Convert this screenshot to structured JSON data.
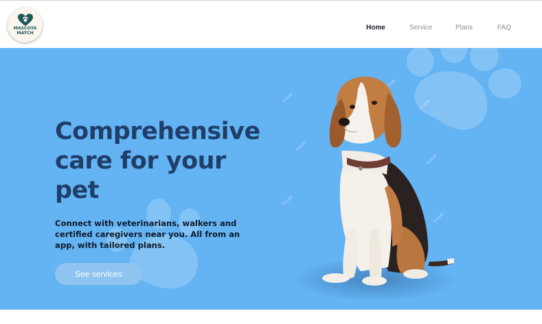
{
  "brand": {
    "logo_line1": "MASCOTA",
    "logo_line2": "MATCH",
    "logo_icon": "heart-paw-icon",
    "logo_color": "#1d5a57"
  },
  "nav": {
    "items": [
      {
        "label": "Home",
        "active": true
      },
      {
        "label": "Service",
        "active": false
      },
      {
        "label": "Plans",
        "active": false
      },
      {
        "label": "FAQ",
        "active": false
      }
    ]
  },
  "hero": {
    "title": "Comprehensive care for your pet",
    "subtitle": "Connect with veterinarians, walkers and certified caregivers near you. All from an app, with tailored plans.",
    "cta_label": "See services",
    "image": "beagle-dog-photo",
    "decorations": "paw-print-icon",
    "background_color": "#64b3f3",
    "title_color": "#1f3f6a"
  }
}
